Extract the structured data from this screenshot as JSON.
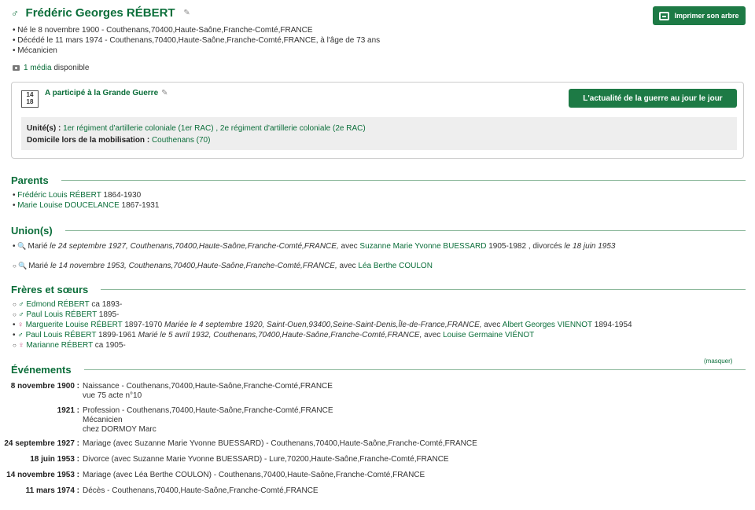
{
  "person": {
    "sex_symbol": "♂",
    "name": "Frédéric Georges RÉBERT",
    "facts": [
      "Né le 8 novembre 1900 - Couthenans,70400,Haute-Saône,Franche-Comté,FRANCE",
      "Décédé le 11 mars 1974 - Couthenans,70400,Haute-Saône,Franche-Comté,FRANCE, à l'âge de 73 ans",
      "Mécanicien"
    ],
    "media_link": "1 média",
    "media_suffix": " disponible"
  },
  "print_button": "Imprimer son arbre",
  "war": {
    "badge_top": "14",
    "badge_bottom": "18",
    "title": "A participé à la Grande Guerre",
    "news_button": "L'actualité de la guerre au jour le jour",
    "unit_label": "Unité(s) :",
    "unit_1": "1er régiment d'artillerie coloniale (1er RAC)",
    "unit_sep": " , ",
    "unit_2": "2e régiment d'artillerie coloniale (2e RAC)",
    "domicile_label": "Domicile lors de la mobilisation :",
    "domicile_value": "Couthenans (70)"
  },
  "parents": {
    "heading": "Parents",
    "items": [
      {
        "name": "Frédéric Louis RÉBERT",
        "dates": " 1864-1930"
      },
      {
        "name": "Marie Louise DOUCELANCE",
        "dates": " 1867-1931"
      }
    ]
  },
  "unions": {
    "heading": "Union(s)",
    "u1_pre": "Marié",
    "u1_italic": " le 24 septembre 1927, Couthenans,70400,Haute-Saône,Franche-Comté,FRANCE,",
    "u1_avec": " avec ",
    "u1_spouse": "Suzanne Marie Yvonne BUESSARD",
    "u1_dates": " 1905-1982 , divorcés ",
    "u1_div": "le 18 juin 1953",
    "u2_pre": "Marié",
    "u2_italic": " le 14 novembre 1953, Couthenans,70400,Haute-Saône,Franche-Comté,FRANCE,",
    "u2_avec": " avec ",
    "u2_spouse": "Léa Berthe COULON"
  },
  "siblings": {
    "heading": "Frères et sœurs",
    "s1_name": "Edmond RÉBERT",
    "s1_dates": " ca 1893-",
    "s2_name": "Paul Louis RÉBERT",
    "s2_dates": " 1895-",
    "s3_name": "Marguerite Louise RÉBERT",
    "s3_dates": " 1897-1970 ",
    "s3_italic": "Mariée le 4 septembre 1920, Saint-Ouen,93400,Seine-Saint-Denis,Île-de-France,FRANCE,",
    "s3_avec": " avec ",
    "s3_spouse": "Albert Georges VIENNOT",
    "s3_sdates": " 1894-1954",
    "s4_name": "Paul Louis RÉBERT",
    "s4_dates": " 1899-1961 ",
    "s4_italic": "Marié le 5 avril 1932, Couthenans,70400,Haute-Saône,Franche-Comté,FRANCE,",
    "s4_avec": " avec ",
    "s4_spouse": "Louise Germaine VIÉNOT",
    "s5_name": "Marianne RÉBERT",
    "s5_dates": " ca 1905-"
  },
  "events": {
    "heading": "Événements",
    "hide_link": "(masquer)",
    "items": [
      {
        "date": "8 novembre 1900 :",
        "lines": [
          "Naissance - Couthenans,70400,Haute-Saône,Franche-Comté,FRANCE",
          "vue 75 acte n°10"
        ]
      },
      {
        "date": "1921 :",
        "lines": [
          "Profession - Couthenans,70400,Haute-Saône,Franche-Comté,FRANCE",
          "Mécanicien",
          "chez DORMOY Marc"
        ]
      },
      {
        "date": "24 septembre 1927 :",
        "lines": [
          "Mariage (avec Suzanne Marie Yvonne BUESSARD) - Couthenans,70400,Haute-Saône,Franche-Comté,FRANCE"
        ]
      },
      {
        "date": "18 juin 1953 :",
        "lines": [
          "Divorce (avec Suzanne Marie Yvonne BUESSARD) - Lure,70200,Haute-Saône,Franche-Comté,FRANCE"
        ]
      },
      {
        "date": "14 novembre 1953 :",
        "lines": [
          "Mariage (avec Léa Berthe COULON) - Couthenans,70400,Haute-Saône,Franche-Comté,FRANCE"
        ]
      },
      {
        "date": "11 mars 1974 :",
        "lines": [
          "Décès - Couthenans,70400,Haute-Saône,Franche-Comté,FRANCE"
        ]
      }
    ]
  }
}
